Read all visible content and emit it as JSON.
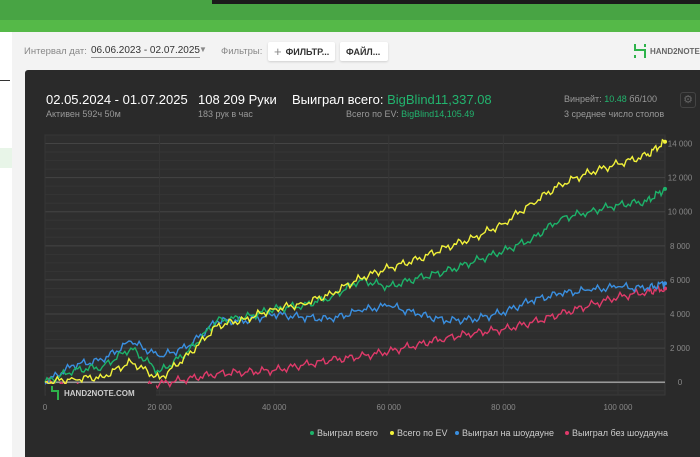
{
  "toolbar": {
    "date_label": "Интервал дат:",
    "date_value": "06.06.2023 - 02.07.2025",
    "filters_label": "Фильтры:",
    "filter_button": "ФИЛЬТР...",
    "file_button": "ФАЙЛ...",
    "logo_text": "HAND2NOTE"
  },
  "summary": {
    "period": "02.05.2024 - 01.07.2025",
    "active": "Активен 592ч 50м",
    "hands": "108 209 Руки",
    "hands_per_hour": "183 рук в час",
    "won_label": "Выиграл всего:",
    "won_value": "BigBlind11,337.08",
    "ev_label": "Всего по EV:",
    "ev_value": "BigBlind14,105.49",
    "winrate_label": "Винрейт:",
    "winrate_value": "10.48",
    "winrate_unit": "бб/100",
    "tables": "3 среднее число столов"
  },
  "watermark": "HAND2NOTE.COM",
  "colors": {
    "green": "#1db36a",
    "yellow": "#f2f23a",
    "blue": "#3a8fe0",
    "pink": "#e03a6a"
  },
  "chart_data": {
    "type": "line",
    "x": [
      0,
      5000,
      10000,
      15000,
      20000,
      25000,
      30000,
      35000,
      40000,
      45000,
      50000,
      55000,
      60000,
      65000,
      70000,
      75000,
      80000,
      85000,
      90000,
      95000,
      100000,
      105000,
      108209
    ],
    "xlim": [
      0,
      108209
    ],
    "ylim": [
      -750,
      14500
    ],
    "x_ticks": [
      "0",
      "20 000",
      "40 000",
      "60 000",
      "80 000",
      "100 000"
    ],
    "x_tick_values": [
      0,
      20000,
      40000,
      60000,
      80000,
      100000
    ],
    "y_ticks": [
      "0",
      "2 000",
      "4 000",
      "6 000",
      "8 000",
      "10 000",
      "12 000",
      "14 000"
    ],
    "y_tick_values": [
      0,
      2000,
      4000,
      6000,
      8000,
      10000,
      12000,
      14000
    ],
    "legend_position": "bottom-right",
    "grid": true,
    "series": [
      {
        "name": "Выиграл всего",
        "color": "#1db36a",
        "values": [
          0,
          700,
          900,
          2000,
          600,
          1800,
          3600,
          3800,
          4300,
          4500,
          5000,
          6000,
          5600,
          6100,
          6500,
          7100,
          7700,
          8400,
          9600,
          10000,
          10400,
          10600,
          11337
        ]
      },
      {
        "name": "Всего по EV",
        "color": "#f2f23a",
        "values": [
          0,
          200,
          300,
          1200,
          200,
          1600,
          3300,
          3700,
          4300,
          4600,
          5200,
          6100,
          6700,
          7200,
          7900,
          8500,
          9300,
          10500,
          11600,
          12300,
          12800,
          13300,
          14105
        ]
      },
      {
        "name": "Выиграл на шоудауне",
        "color": "#3a8fe0",
        "values": [
          0,
          1000,
          1300,
          2400,
          1500,
          2100,
          3600,
          3600,
          4000,
          3800,
          3700,
          4200,
          4500,
          4000,
          3600,
          3700,
          4100,
          4800,
          5200,
          5400,
          5600,
          5500,
          5800
        ]
      },
      {
        "name": "Выиграл без шоудауна",
        "color": "#e03a6a",
        "values": [
          0,
          -300,
          -500,
          -400,
          -100,
          200,
          500,
          600,
          700,
          1000,
          1300,
          1500,
          1800,
          2200,
          2600,
          2900,
          3100,
          3500,
          4000,
          4500,
          5000,
          5300,
          5500
        ]
      }
    ]
  }
}
